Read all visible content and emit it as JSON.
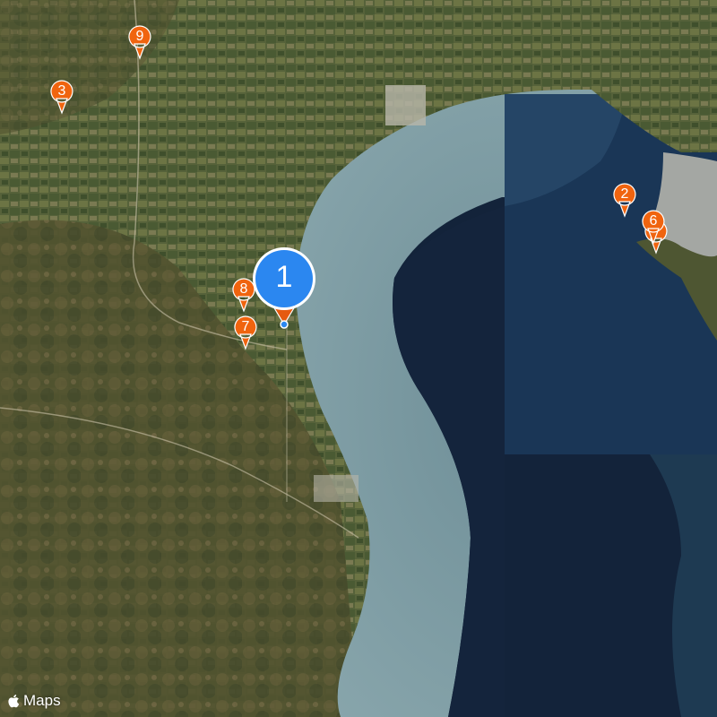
{
  "colors": {
    "land": "#4d5a34",
    "land_hills": "#5b5634",
    "shallow_sea": "#7f9ea6",
    "mid_sea": "#3f6571",
    "deep_sea": "#14243c",
    "bay_tile": "#1b3758",
    "town": "#bdbbb0",
    "pin_orange": "#f0640f",
    "pin_blue": "#2b87f0",
    "pin_border": "#ffffff"
  },
  "markers": [
    {
      "label": "1",
      "color": "blue",
      "size": "large",
      "selected": true
    },
    {
      "label": "2",
      "color": "orange",
      "size": "small"
    },
    {
      "label": "3",
      "color": "orange",
      "size": "small"
    },
    {
      "label": "6",
      "color": "orange",
      "size": "small"
    },
    {
      "label": "7",
      "color": "orange",
      "size": "small"
    },
    {
      "label": "8",
      "color": "orange",
      "size": "small"
    },
    {
      "label": "9",
      "color": "orange",
      "size": "small"
    }
  ],
  "attribution": {
    "logo_icon": "apple-logo-icon",
    "text": "Maps"
  }
}
